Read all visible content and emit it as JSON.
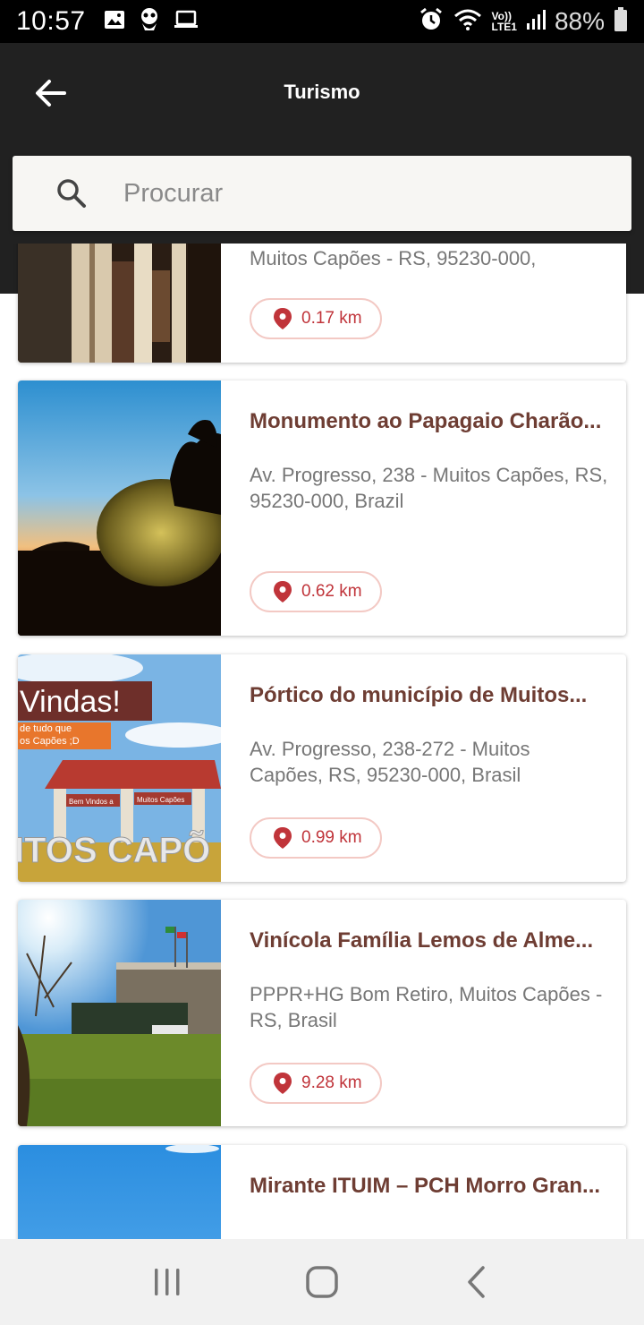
{
  "status_bar": {
    "time": "10:57",
    "battery": "88%",
    "icons": [
      "gallery-icon",
      "mascot-icon",
      "laptop-icon",
      "alarm-icon",
      "wifi-icon",
      "volte-icon",
      "signal-icon",
      "battery-icon"
    ],
    "volte_label": "Vo))",
    "lte_label": "LTE1"
  },
  "app_bar": {
    "title": "Turismo",
    "back_icon": "arrow-left-icon"
  },
  "search": {
    "placeholder": "Procurar",
    "icon": "search-icon"
  },
  "places": [
    {
      "title": "",
      "address": "Muitos Capões - RS, 95230-000,",
      "distance": "0.17 km"
    },
    {
      "title": "Monumento ao Papagaio Charão...",
      "address": "Av. Progresso, 238 - Muitos Capões, RS, 95230-000, Brazil",
      "distance": "0.62 km"
    },
    {
      "title": "Pórtico do município de Muitos...",
      "address": "Av. Progresso, 238-272 - Muitos Capões, RS, 95230-000, Brasil",
      "distance": "0.99 km",
      "image_text": {
        "banner": "Vindas!",
        "sub1": "de tudo que",
        "sub2": "os Capões ;D",
        "sign_left": "Bem Vindos a",
        "sign_right": "Muitos Capões",
        "letters": "ITOS CAPÕ"
      }
    },
    {
      "title": "Vinícola Família Lemos de Alme...",
      "address": "PPPR+HG Bom Retiro, Muitos Capões - RS, Brasil",
      "distance": "9.28 km"
    },
    {
      "title": "Mirante ITUIM – PCH Morro Gran...",
      "address": "",
      "distance": ""
    }
  ],
  "nav_bar": {
    "recents_icon": "recents-icon",
    "home_icon": "home-icon",
    "back_icon": "nav-back-icon"
  },
  "colors": {
    "app_bar": "#212121",
    "title_text": "#6e3d33",
    "distance_text": "#c0343a",
    "chip_border": "#f3c9c4"
  }
}
